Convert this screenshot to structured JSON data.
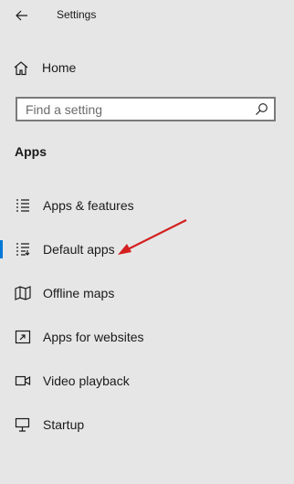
{
  "window": {
    "title": "Settings"
  },
  "home": {
    "label": "Home"
  },
  "search": {
    "placeholder": "Find a setting"
  },
  "section": {
    "title": "Apps"
  },
  "nav": {
    "items": [
      {
        "label": "Apps & features",
        "icon": "apps-features-icon"
      },
      {
        "label": "Default apps",
        "icon": "default-apps-icon",
        "selected": true
      },
      {
        "label": "Offline maps",
        "icon": "map-icon"
      },
      {
        "label": "Apps for websites",
        "icon": "web-link-icon"
      },
      {
        "label": "Video playback",
        "icon": "video-icon"
      },
      {
        "label": "Startup",
        "icon": "startup-icon"
      }
    ]
  },
  "colors": {
    "accent": "#0078d7",
    "annotation_arrow": "#d42020",
    "background": "#e6e6e6"
  }
}
